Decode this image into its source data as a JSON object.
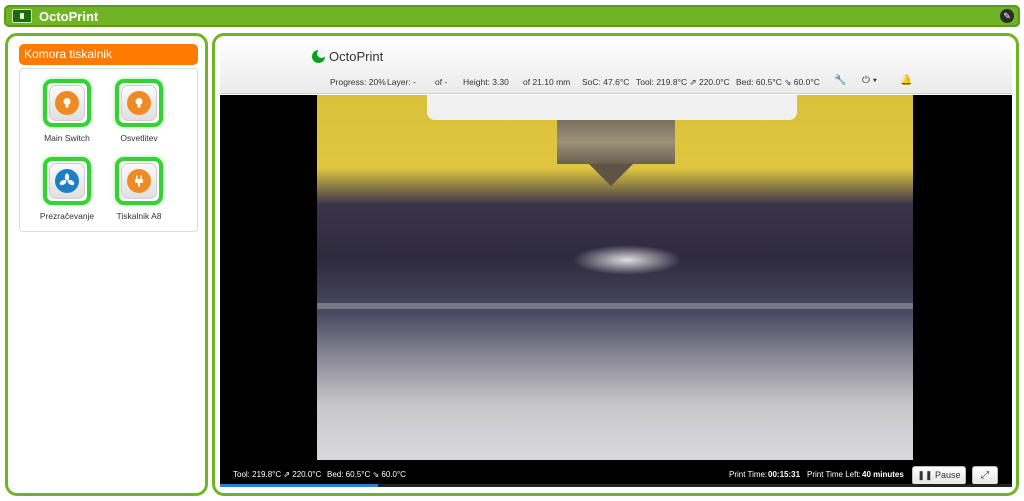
{
  "app": {
    "title": "OctoPrint"
  },
  "left": {
    "header": "Komora tiskalnik",
    "tiles": [
      {
        "label": "Main Switch",
        "icon": "lightbulb-icon",
        "color": "#f08a24"
      },
      {
        "label": "Osvetlitev",
        "icon": "lightbulb-icon",
        "color": "#f08a24"
      },
      {
        "label": "Prezračevanje",
        "icon": "fan-icon",
        "color": "#1f7fc3"
      },
      {
        "label": "Tiskalnik A8",
        "icon": "plug-icon",
        "color": "#f08a24"
      }
    ]
  },
  "octoprint": {
    "brand": "OctoPrint",
    "status": {
      "progress": "Progress: 20%",
      "layer": "Layer: -",
      "layer_of": "of -",
      "height": "Height: 3.30",
      "height_of": "of 21.10  mm",
      "soc": "SoC: 47.6°C",
      "tool": "Tool: 219.8°C ⇗ 220.0°C",
      "bed": "Bed: 60.5°C ⇘ 60.0°C"
    },
    "overlay": {
      "tool": "Tool: 219.8°C ⇗ 220.0°C",
      "bed": "Bed: 60.5°C ⇘ 60.0°C",
      "print_time_label": "Print Time:",
      "print_time_value": "00:15:31",
      "print_time_left_label": "Print Time Left:",
      "print_time_left_value": "40 minutes",
      "pause_label": "Pause",
      "progress_fraction": 0.2
    }
  }
}
